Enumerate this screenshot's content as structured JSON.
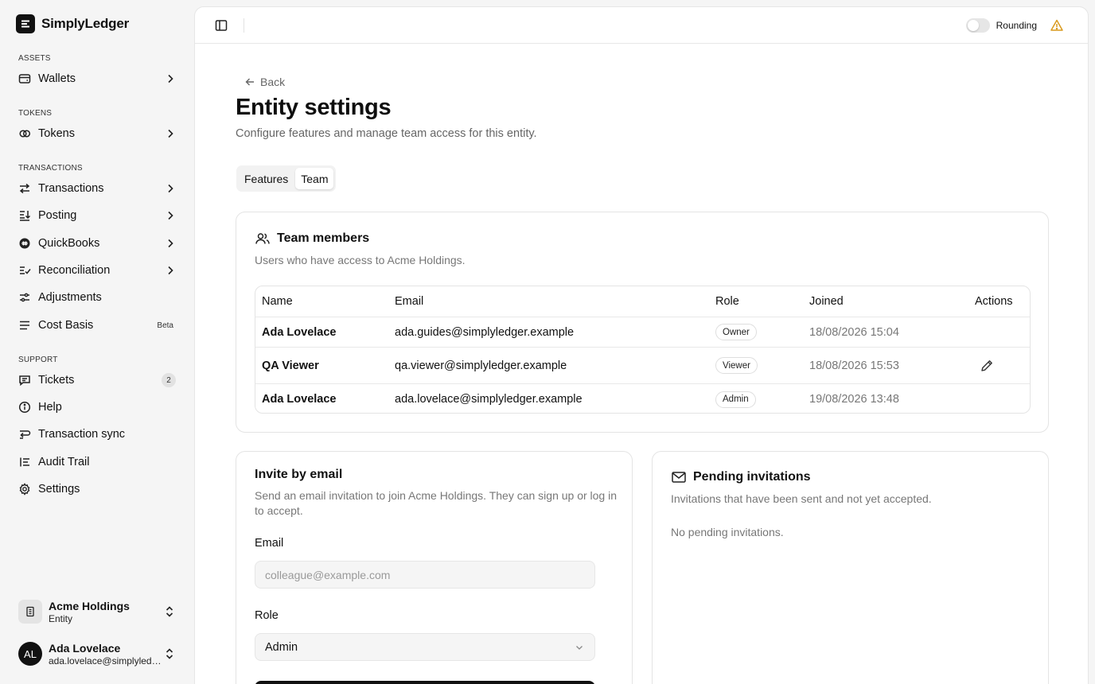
{
  "brand": {
    "name": "SimplyLedger"
  },
  "sidebar": {
    "sections": {
      "assets": "ASSETS",
      "tokens": "TOKENS",
      "transactions": "TRANSACTIONS",
      "support": "SUPPORT"
    },
    "items": [
      {
        "label": "Wallets",
        "icon": "wallet-icon"
      },
      {
        "label": "Tokens",
        "icon": "coins-icon"
      },
      {
        "label": "Transactions",
        "icon": "arrows-left-right-icon"
      },
      {
        "label": "Posting",
        "icon": "posting-icon"
      },
      {
        "label": "QuickBooks",
        "icon": "quickbooks-icon"
      },
      {
        "label": "Reconciliation",
        "icon": "list-check-icon"
      },
      {
        "label": "Adjustments",
        "icon": "sliders-icon"
      },
      {
        "label": "Cost Basis",
        "icon": "stack-icon",
        "badge": "Beta"
      },
      {
        "label": "Tickets",
        "icon": "message-icon",
        "count": "2"
      },
      {
        "label": "Help",
        "icon": "info-icon"
      },
      {
        "label": "Transaction sync",
        "icon": "sync-icon"
      },
      {
        "label": "Audit Trail",
        "icon": "list-ordered-icon"
      },
      {
        "label": "Settings",
        "icon": "gear-icon"
      }
    ],
    "entity": {
      "name": "Acme Holdings",
      "type": "Entity"
    },
    "user": {
      "initials": "AL",
      "name": "Ada Lovelace",
      "email": "ada.lovelace@simplyledger.example"
    }
  },
  "topbar": {
    "toggle_label": "Rounding",
    "toggle_on": false
  },
  "page": {
    "back_label": "Back",
    "title": "Entity settings",
    "subtitle": "Configure features and manage team access for this entity.",
    "tabs": [
      "Features",
      "Team"
    ],
    "active_tab": "Team"
  },
  "team": {
    "title": "Team members",
    "description": "Users who have access to Acme Holdings.",
    "columns": [
      "Name",
      "Email",
      "Role",
      "Joined",
      "Actions"
    ],
    "rows": [
      {
        "name": "Ada Lovelace",
        "email": "ada.guides@simplyledger.example",
        "role": "Owner",
        "joined": "18/08/2026 15:04"
      },
      {
        "name": "QA Viewer",
        "email": "qa.viewer@simplyledger.example",
        "role": "Viewer",
        "joined": "18/08/2026 15:53"
      },
      {
        "name": "Ada Lovelace",
        "email": "ada.lovelace@simplyledger.example",
        "role": "Admin",
        "joined": "19/08/2026 13:48"
      }
    ]
  },
  "invite": {
    "title": "Invite by email",
    "description": "Send an email invitation to join Acme Holdings. They can sign up or log in to accept.",
    "email_label": "Email",
    "email_placeholder": "colleague@example.com",
    "role_label": "Role",
    "role_value": "Admin"
  },
  "pending": {
    "title": "Pending invitations",
    "description": "Invitations that have been sent and not yet accepted.",
    "empty_text": "No pending invitations."
  },
  "colors": {
    "accent": "#111111",
    "warning": "#d99a1e"
  }
}
